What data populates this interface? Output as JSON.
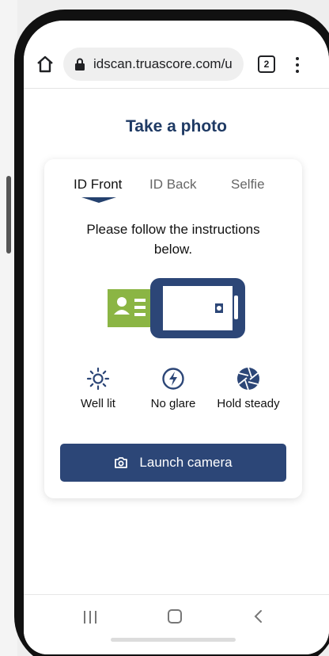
{
  "browser": {
    "url": "idscan.truascore.com/u:",
    "tab_count": "2",
    "icons": [
      "home-icon",
      "lock-icon",
      "tabs-icon",
      "more-vert-icon"
    ]
  },
  "page": {
    "title": "Take a photo"
  },
  "card": {
    "tabs": [
      {
        "label": "ID Front",
        "active": true
      },
      {
        "label": "ID Back",
        "active": false
      },
      {
        "label": "Selfie",
        "active": false
      }
    ],
    "instructions": "Please follow the instructions below.",
    "tips": [
      {
        "label": "Well lit",
        "icon": "sun-icon"
      },
      {
        "label": "No glare",
        "icon": "flash-off-icon"
      },
      {
        "label": "Hold steady",
        "icon": "aperture-icon"
      }
    ],
    "launch_label": "Launch camera"
  },
  "nav": {
    "icons": [
      "recent-apps-icon",
      "home-icon",
      "back-icon"
    ]
  },
  "colors": {
    "primary": "#2c4677",
    "title": "#1f3a64",
    "id_card_green": "#8bb544"
  }
}
